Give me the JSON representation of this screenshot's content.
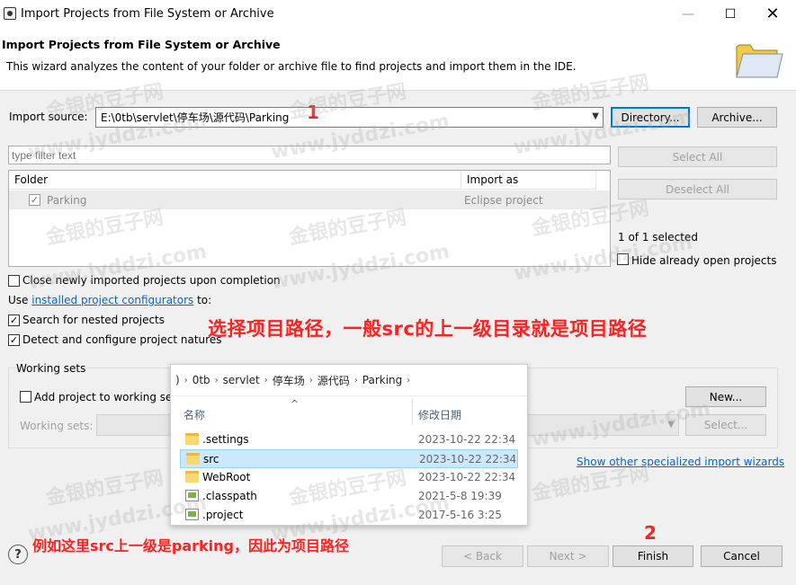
{
  "window": {
    "title": "Import Projects from File System or Archive",
    "minimize": "—",
    "maximize": "☐",
    "close": "✕"
  },
  "header": {
    "heading": "Import Projects from File System or Archive",
    "description": "This wizard analyzes the content of your folder or archive file to find projects and import them in the IDE."
  },
  "import_source": {
    "label": "Import source:",
    "value": "E:\\0tb\\servlet\\停车场\\源代码\\Parking",
    "directory_button": "Directory...",
    "archive_button": "Archive..."
  },
  "filter": {
    "placeholder": "type filter text"
  },
  "table": {
    "col_folder": "Folder",
    "col_import_as": "Import as",
    "rows": [
      {
        "checked": "✓",
        "folder": "Parking",
        "import_as": "Eclipse project"
      }
    ]
  },
  "side": {
    "select_all": "Select All",
    "deselect_all": "Deselect All",
    "selection_count": "1 of 1 selected",
    "hide_open": "Hide already open projects"
  },
  "options": {
    "close_newly": "Close newly imported projects upon completion",
    "use_prefix": "Use ",
    "configurators_link": "installed project configurators",
    "use_suffix": " to:",
    "search_nested": "Search for nested projects",
    "search_nested_check": "✓",
    "detect_natures": "Detect and configure project natures",
    "detect_natures_check": "✓"
  },
  "working_sets": {
    "title": "Working sets",
    "add_label": "Add project to working se",
    "new_button": "New...",
    "sets_label": "Working sets:",
    "select_button": "Select..."
  },
  "link": {
    "show_wizards": "Show other specialized import wizards"
  },
  "footer": {
    "help": "?",
    "back": "< Back",
    "next": "Next >",
    "finish": "Finish",
    "cancel": "Cancel"
  },
  "annotations": {
    "one": "1",
    "two": "2",
    "main": "选择项目路径，一般src的上一级目录就是项目路径",
    "bottom": "例如这里src上一级是parking，因此为项目路径"
  },
  "explorer": {
    "breadcrumb": [
      ")",
      "0tb",
      "servlet",
      "停车场",
      "源代码",
      "Parking"
    ],
    "sep": "›",
    "caret": "^",
    "col_name": "名称",
    "col_date": "修改日期",
    "files": [
      {
        "name": ".settings",
        "date": "2023-10-22 22:34",
        "type": "folder"
      },
      {
        "name": "src",
        "date": "2023-10-22 22:34",
        "type": "folder"
      },
      {
        "name": "WebRoot",
        "date": "2023-10-22 22:34",
        "type": "folder"
      },
      {
        "name": ".classpath",
        "date": "2021-5-8 19:39",
        "type": "file"
      },
      {
        "name": ".project",
        "date": "2017-5-16 3:25",
        "type": "file"
      }
    ]
  },
  "watermark": {
    "cn": "金银的豆子网",
    "url": "www.jyddzi.com"
  },
  "colors": {
    "annotation": "#ff2020",
    "link": "#0066cc",
    "selection": "#cce8ff"
  }
}
